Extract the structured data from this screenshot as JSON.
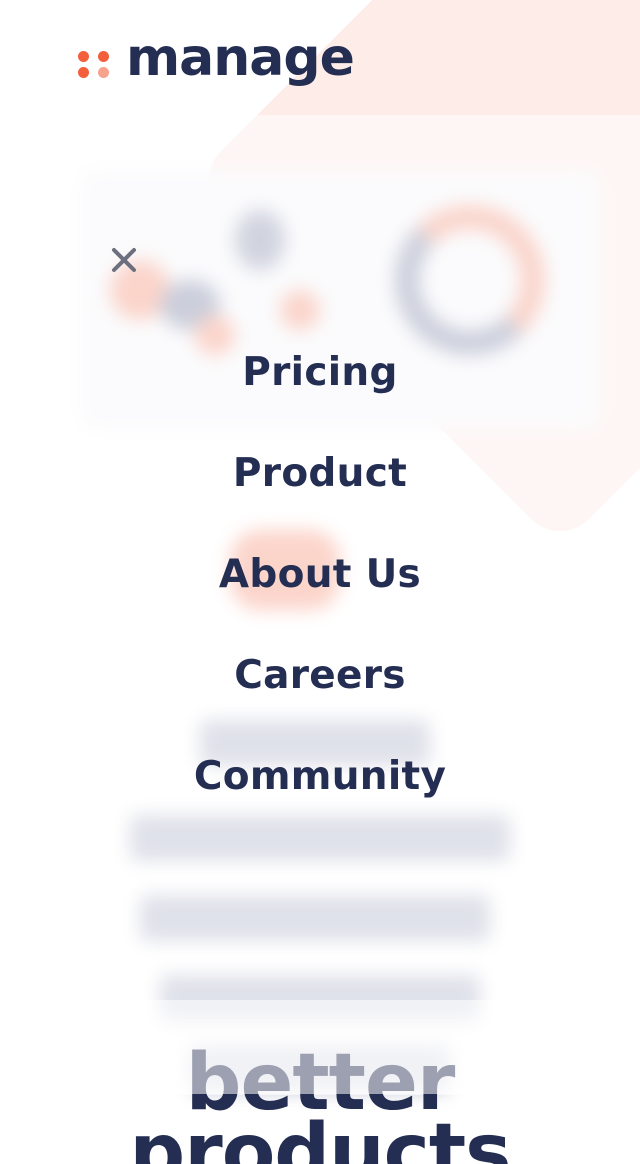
{
  "brand": {
    "name": "manage",
    "colors": {
      "accent": "#f25f3a",
      "accent_light": "#f7a28c",
      "navy": "#242d52",
      "bg_peach": "#fdece7"
    }
  },
  "menu": {
    "close_icon": "close-icon",
    "items": [
      {
        "label": "Pricing"
      },
      {
        "label": "Product"
      },
      {
        "label": "About Us"
      },
      {
        "label": "Careers"
      },
      {
        "label": "Community"
      }
    ]
  },
  "hero": {
    "headline_lines": [
      "better",
      "products"
    ]
  }
}
